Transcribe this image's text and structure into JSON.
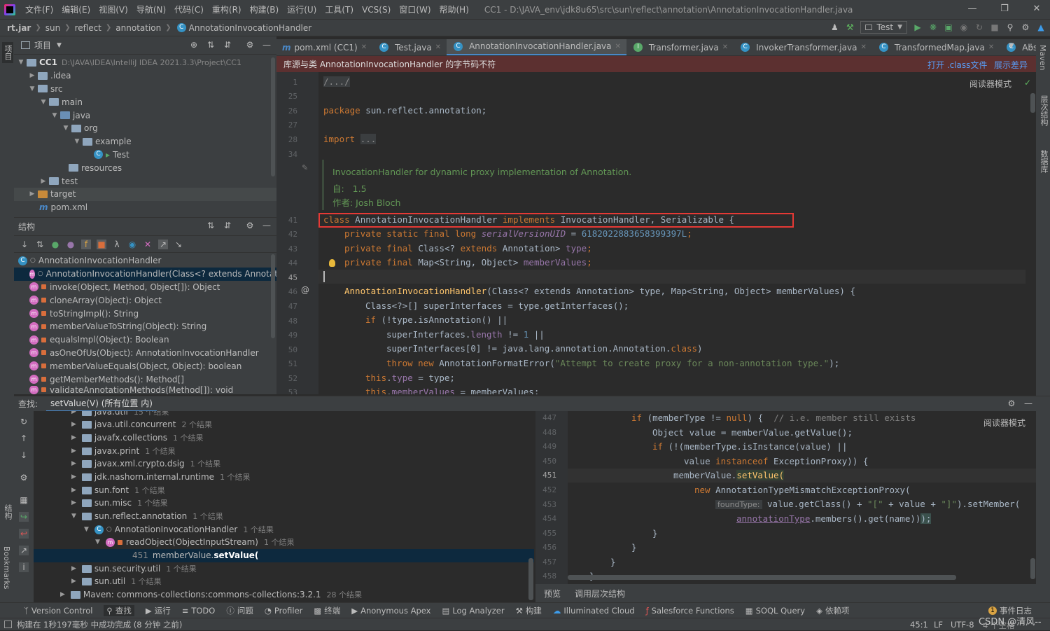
{
  "window": {
    "menus": [
      "文件(F)",
      "编辑(E)",
      "视图(V)",
      "导航(N)",
      "代码(C)",
      "重构(R)",
      "构建(B)",
      "运行(U)",
      "工具(T)",
      "VCS(S)",
      "窗口(W)",
      "帮助(H)"
    ],
    "title": "CC1 - D:\\JAVA_env\\jdk8u65\\src\\sun\\reflect\\annotation\\AnnotationInvocationHandler.java"
  },
  "breadcrumb": [
    "rt.jar",
    "sun",
    "reflect",
    "annotation",
    "AnnotationInvocationHandler"
  ],
  "run_config": "Test",
  "left_strip": {
    "project": "项目",
    "structure": "结构",
    "bookmarks": "Bookmarks"
  },
  "right_strip": {
    "maven": "Maven",
    "hierarchy": "层次结构",
    "database": "数据库"
  },
  "project_panel": {
    "title": "项目",
    "rows": [
      {
        "label": "CC1",
        "note": "D:\\JAVA\\IDEA\\IntelliJ IDEA 2021.3.3\\Project\\CC1"
      },
      {
        "label": ".idea"
      },
      {
        "label": "src"
      },
      {
        "label": "main"
      },
      {
        "label": "java"
      },
      {
        "label": "org"
      },
      {
        "label": "example"
      },
      {
        "label": "Test"
      },
      {
        "label": "resources"
      },
      {
        "label": "test"
      },
      {
        "label": "target"
      },
      {
        "label": "pom.xml"
      }
    ]
  },
  "structure_panel": {
    "title": "结构",
    "class_name": "AnnotationInvocationHandler",
    "members": [
      "AnnotationInvocationHandler(Class<? extends Annotation>",
      "invoke(Object, Method, Object[]): Object",
      "cloneArray(Object): Object",
      "toStringImpl(): String",
      "memberValueToString(Object): String",
      "equalsImpl(Object): Boolean",
      "asOneOfUs(Object): AnnotationInvocationHandler",
      "memberValueEquals(Object, Object): boolean",
      "getMemberMethods(): Method[]",
      "validateAnnotationMethods(Method[]): void"
    ]
  },
  "tabs": [
    "pom.xml (CC1)",
    "Test.java",
    "AnnotationInvocationHandler.java",
    "Transformer.java",
    "InvokerTransformer.java",
    "TransformedMap.java",
    "AbstractInputC"
  ],
  "banner": {
    "text": "库源与类 AnnotationInvocationHandler 的字节码不符",
    "open_class": "打开 .class文件",
    "show_diff": "展示差异"
  },
  "reader_mode": "阅读器模式",
  "editor": {
    "line_numbers": [
      "1",
      "25",
      "26",
      "27",
      "28",
      "34",
      "",
      "",
      "",
      "41",
      "42",
      "43",
      "44",
      "45",
      "46",
      "47",
      "48",
      "49",
      "50",
      "51",
      "52",
      "53"
    ],
    "fold": "/.../",
    "package_line": "sun.reflect.annotation;",
    "import_dots": "...",
    "doc_line1": "InvocationHandler for dynamic proxy implementation of Annotation.",
    "doc_since_label": "自:",
    "doc_since": "1.5",
    "doc_author": "作者: Josh Bloch",
    "class_decl": {
      "name": "AnnotationInvocationHandler",
      "iface": "InvocationHandler, Serializable {"
    },
    "serial": "6182022883658399397L",
    "ctor_sig": "(Class<? extends Annotation> type, Map<String, Object> memberValues) {",
    "l47": "Class<?>[] superInterfaces = type.getInterfaces();",
    "l48": "(!type.isAnnotation() ||",
    "l49a": "superInterfaces.",
    "l49b": " != ",
    "l49c": " ||",
    "l50": "superInterfaces[0] != java.lang.annotation.Annotation.",
    "l51": "\"Attempt to create proxy for a non-annotation type.\"",
    "l51b": "AnnotationFormatError(",
    "l52": " = type;",
    "l53": " = memberValues;"
  },
  "find": {
    "label": "查找:",
    "query": "setValue(V) (所有位置 内)",
    "rows": [
      {
        "label": "java.util",
        "count": "15 个结果"
      },
      {
        "label": "java.util.concurrent",
        "count": "2 个结果"
      },
      {
        "label": "javafx.collections",
        "count": "1 个结果"
      },
      {
        "label": "javax.print",
        "count": "1 个结果"
      },
      {
        "label": "javax.xml.crypto.dsig",
        "count": "1 个结果"
      },
      {
        "label": "jdk.nashorn.internal.runtime",
        "count": "1 个结果"
      },
      {
        "label": "sun.font",
        "count": "1 个结果"
      },
      {
        "label": "sun.misc",
        "count": "1 个结果"
      },
      {
        "label": "sun.reflect.annotation",
        "count": "1 个结果"
      },
      {
        "label": "AnnotationInvocationHandler",
        "count": "1 个结果"
      },
      {
        "label": "readObject(ObjectInputStream)",
        "count": "1 个结果"
      },
      {
        "label": "451",
        "count": ""
      },
      {
        "label": "sun.security.util",
        "count": "1 个结果"
      },
      {
        "label": "sun.util",
        "count": "1 个结果"
      },
      {
        "label": "Maven: commons-collections:commons-collections:3.2.1",
        "count": "28 个结果"
      }
    ],
    "usage_a": "memberValue.",
    "usage_b": "setValue("
  },
  "preview": {
    "lines": [
      "447",
      "448",
      "449",
      "450",
      "451",
      "452",
      "453",
      "454",
      "455",
      "456",
      "457",
      "458"
    ],
    "reader_mode": "阅读器模式",
    "c447": "(memberType != ",
    "c447c": "// i.e. member still exists",
    "c448": "Object value = memberValue.getValue();",
    "c449": "(!(memberType.isInstance(value) ||",
    "c450a": "value ",
    "c450b": " ExceptionProxy)) {",
    "c451a": "memberValue.",
    "c451b": "setValue(",
    "c452": "AnnotationTypeMismatchExceptionProxy(",
    "c453hint": "foundType:",
    "c453": "value.getClass() + ",
    "c453s1": "\"[\"",
    "c453m": " + value + ",
    "c453s2": "\"]\"",
    "c453e": ").setMember(",
    "c454a": "annotationType",
    "c454b": ".members().get(name))",
    "c454c": ");",
    "tab_preview": "预览",
    "tab_call": "调用层次结构"
  },
  "tool_windows": [
    "Version Control",
    "查找",
    "运行",
    "TODO",
    "问题",
    "Profiler",
    "终端",
    "Anonymous Apex",
    "Log Analyzer",
    "构建",
    "Illuminated Cloud",
    "Salesforce Functions",
    "SOQL Query",
    "依赖项"
  ],
  "event_log": "事件日志",
  "status": {
    "message": "构建在 1秒197毫秒 中成功完成 (8 分钟 之前)",
    "pos": "45:1",
    "lf": "LF",
    "enc": "UTF-8",
    "indent": "4 个空格",
    "watermark": "CSDN @清风--"
  },
  "colors": {
    "highlight_box": "#e53935",
    "banner_bg": "#5c3030",
    "accent": "#4a88c7"
  }
}
